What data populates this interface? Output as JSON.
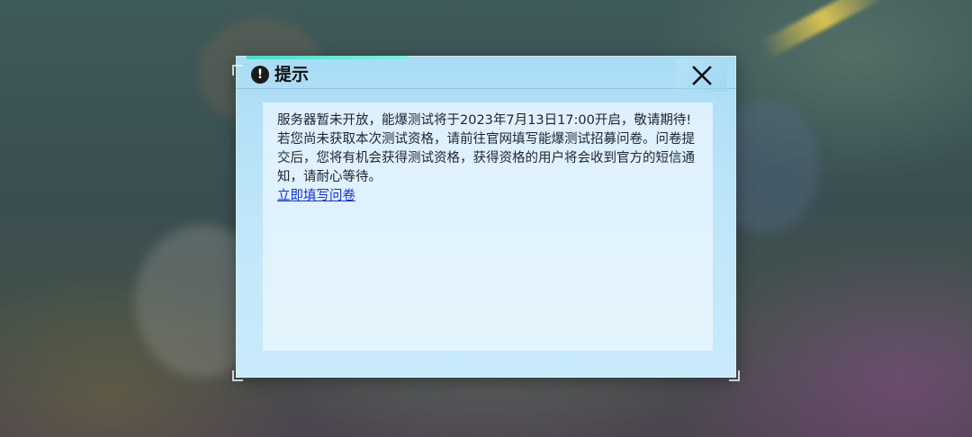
{
  "dialog": {
    "title": "提示",
    "icon": "exclamation-circle-icon",
    "close_icon": "close-x-icon",
    "message_line1": "服务器暂未开放，能爆测试将于2023年7月13日17:00开启，敬请期待!",
    "message_line2": "若您尚未获取本次测试资格，请前往官网填写能爆测试招募问卷。问卷提交后，您将有机会获得测试资格，获得资格的用户将会收到官方的短信通知，请耐心等待。",
    "link_label": "立即填写问卷"
  },
  "colors": {
    "dialog_bg": "#bfe6fa",
    "content_bg": "#e0f2fd",
    "accent": "#3fe0d0",
    "link": "#1530d8"
  }
}
